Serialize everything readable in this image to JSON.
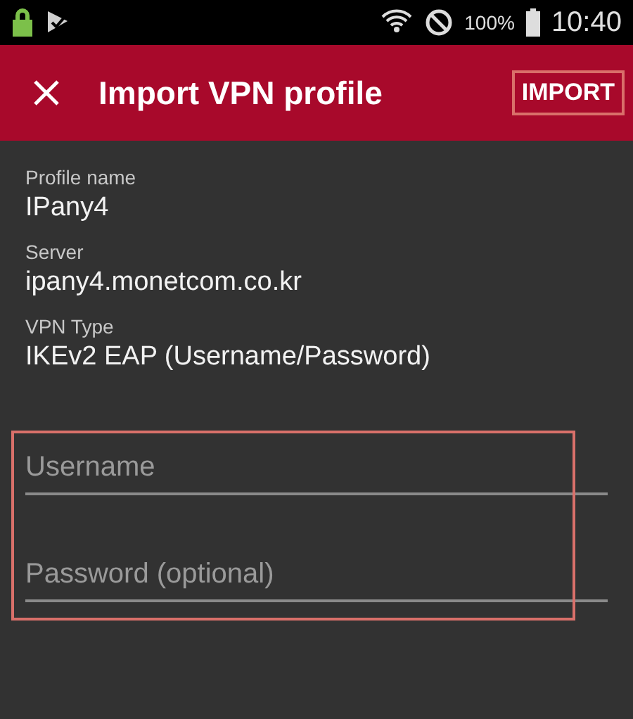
{
  "status_bar": {
    "battery": "100%",
    "time": "10:40"
  },
  "app_bar": {
    "title": "Import VPN profile",
    "action": "IMPORT",
    "action_highlighted": true
  },
  "details": [
    {
      "label": "Profile name",
      "value": "IPany4"
    },
    {
      "label": "Server",
      "value": "ipany4.monetcom.co.kr"
    },
    {
      "label": "VPN Type",
      "value": "IKEv2 EAP (Username/Password)"
    }
  ],
  "inputs_highlighted": true,
  "inputs": [
    {
      "placeholder": "Username"
    },
    {
      "placeholder": "Password (optional)"
    }
  ]
}
